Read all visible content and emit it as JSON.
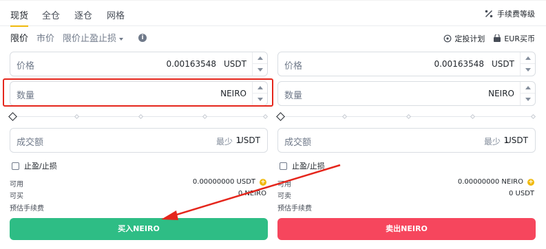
{
  "tabs": [
    "现货",
    "全仓",
    "逐仓",
    "网格"
  ],
  "fee_level": "手续费等级",
  "order_types": {
    "limit": "限价",
    "market": "市价",
    "stop": "限价止盈止损"
  },
  "links": {
    "plan": "定投计划",
    "buy_eur": "EUR买币"
  },
  "buy": {
    "price_label": "价格",
    "price_value": "0.00163548",
    "price_unit": "USDT",
    "amount_label": "数量",
    "amount_unit": "NEIRO",
    "total_label": "成交额",
    "total_min_label": "最少",
    "total_min_value": "1",
    "total_unit": "USDT",
    "tpsl_label": "止盈/止损",
    "available_label": "可用",
    "available_value": "0.00000000 USDT",
    "can_label": "可买",
    "can_value": "0 NEIRO",
    "fee_label": "预估手续费",
    "button": "买入NEIRO"
  },
  "sell": {
    "price_label": "价格",
    "price_value": "0.00163548",
    "price_unit": "USDT",
    "amount_label": "数量",
    "amount_unit": "NEIRO",
    "total_label": "成交额",
    "total_min_label": "最少",
    "total_min_value": "1",
    "total_unit": "USDT",
    "tpsl_label": "止盈/止损",
    "available_label": "可用",
    "available_value": "0.00000000 NEIRO",
    "can_label": "可卖",
    "can_value": "0 USDT",
    "fee_label": "预估手续费",
    "button": "卖出NEIRO"
  },
  "colors": {
    "buy": "#2ebd85",
    "sell": "#f6465d",
    "accent": "#f0b90b",
    "annotation": "#e5261c"
  }
}
